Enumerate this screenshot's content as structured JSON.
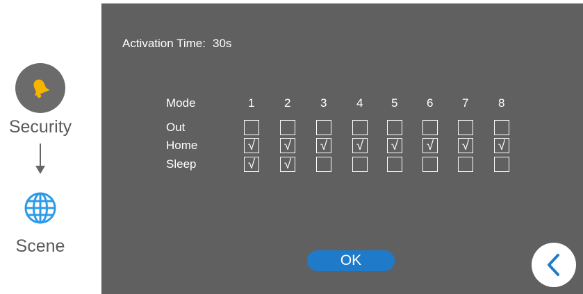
{
  "sidebar": {
    "security_label": "Security",
    "scene_label": "Scene",
    "security_icon": "bell-icon",
    "scene_icon": "globe-icon",
    "flow_icon": "arrow-down-icon"
  },
  "activation": {
    "label": "Activation Time:",
    "value": "30s"
  },
  "table": {
    "mode_header": "Mode",
    "columns": [
      "1",
      "2",
      "3",
      "4",
      "5",
      "6",
      "7",
      "8"
    ],
    "rows": [
      {
        "label": "Out",
        "checked": [
          false,
          false,
          false,
          false,
          false,
          false,
          false,
          false
        ]
      },
      {
        "label": "Home",
        "checked": [
          true,
          true,
          true,
          true,
          true,
          true,
          true,
          true
        ]
      },
      {
        "label": "Sleep",
        "checked": [
          true,
          true,
          false,
          false,
          false,
          false,
          false,
          false
        ]
      }
    ],
    "check_glyph": "√"
  },
  "ok_label": "OK",
  "back_icon": "chevron-left-icon",
  "colors": {
    "panel": "#606060",
    "accent_blue": "#1f7bc9",
    "bell_yellow": "#f7b500",
    "globe_blue": "#2d9be8"
  }
}
